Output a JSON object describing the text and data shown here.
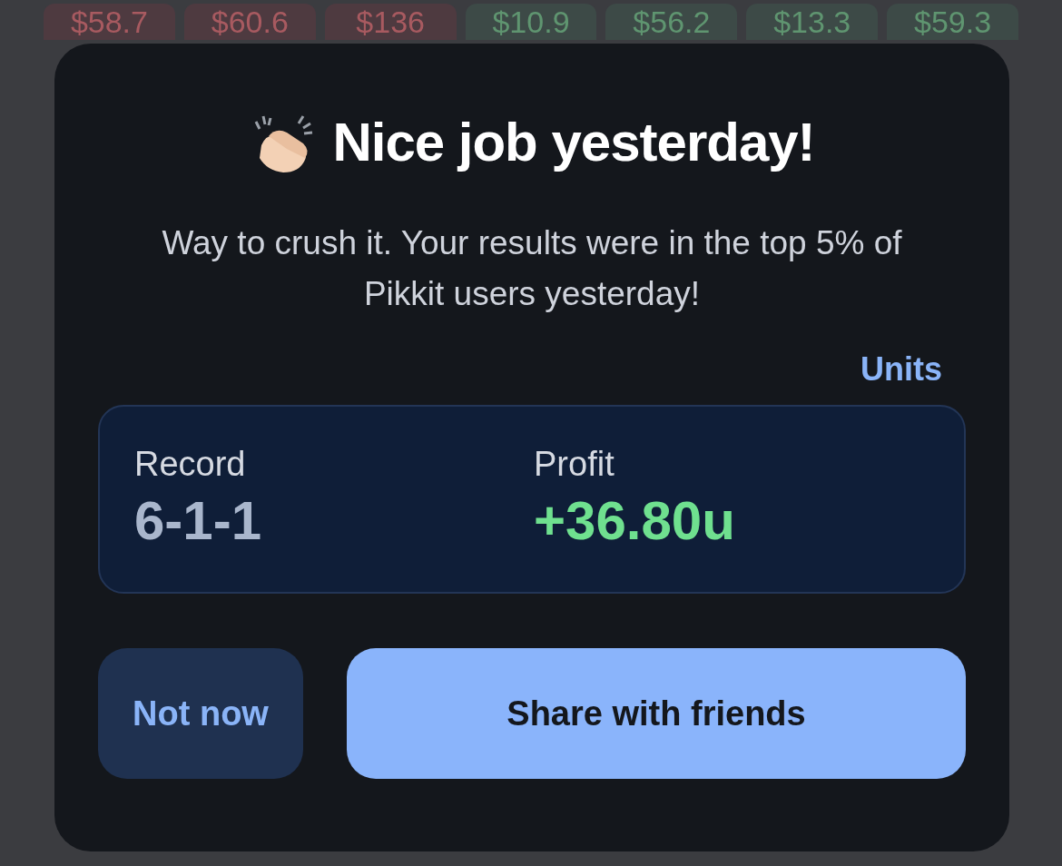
{
  "background_tiles": [
    {
      "amount": "$58.7",
      "kind": "loss"
    },
    {
      "amount": "$60.6",
      "kind": "loss"
    },
    {
      "amount": "$136",
      "kind": "loss"
    },
    {
      "amount": "$10.9",
      "kind": "win"
    },
    {
      "amount": "$56.2",
      "kind": "win"
    },
    {
      "amount": "$13.3",
      "kind": "win"
    },
    {
      "amount": "$59.3",
      "kind": "win"
    }
  ],
  "dialog": {
    "title": "Nice job yesterday!",
    "message": "Way to crush it. Your results were in the top 5% of Pikkit users yesterday!",
    "units_link": "Units",
    "stats": [
      {
        "label": "Record",
        "value": "6-1-1",
        "kind": "neutral"
      },
      {
        "label": "Profit",
        "value": "+36.80u",
        "kind": "positive"
      }
    ],
    "buttons": [
      {
        "label": "Not now",
        "kind": "secondary"
      },
      {
        "label": "Share with friends",
        "kind": "primary"
      }
    ]
  }
}
